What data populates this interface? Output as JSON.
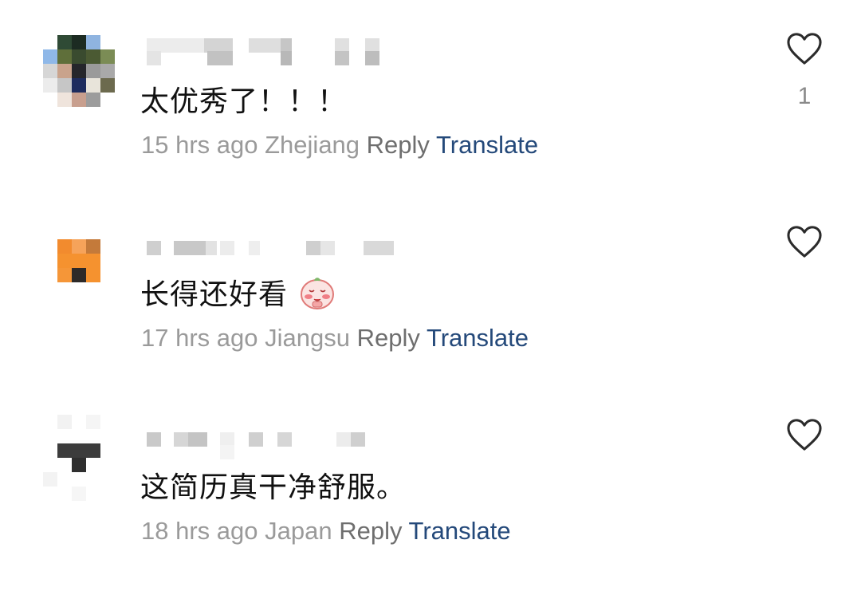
{
  "comments": [
    {
      "text": "太优秀了！！！",
      "time": "15 hrs ago",
      "location": "Zhejiang",
      "reply_label": "Reply",
      "translate_label": "Translate",
      "likes": "1"
    },
    {
      "text": "长得还好看",
      "emoji": "red-blushing-sticker",
      "time": "17 hrs ago",
      "location": "Jiangsu",
      "reply_label": "Reply",
      "translate_label": "Translate"
    },
    {
      "text": "这简历真干净舒服。",
      "time": "18 hrs ago",
      "location": "Japan",
      "reply_label": "Reply",
      "translate_label": "Translate"
    }
  ],
  "icons": {
    "like": "heart-outline-icon"
  },
  "colors": {
    "text": "#111111",
    "meta": "#9a9a9a",
    "translate": "#24497a",
    "icon": "#2b2b2b"
  }
}
